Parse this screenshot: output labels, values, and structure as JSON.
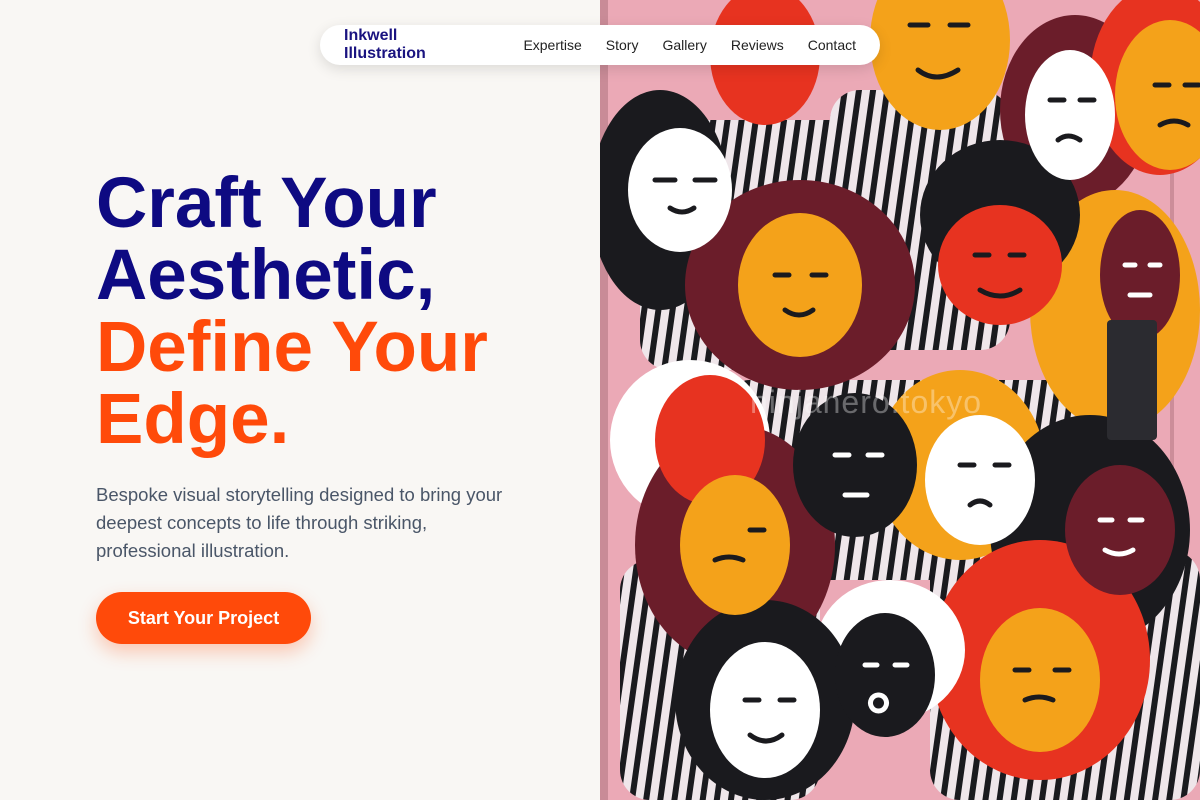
{
  "nav": {
    "brand": "Inkwell Illustration",
    "links": [
      "Expertise",
      "Story",
      "Gallery",
      "Reviews",
      "Contact"
    ]
  },
  "hero": {
    "title_line1": "Craft Your",
    "title_line2": "Aesthetic,",
    "title_line3": "Define Your",
    "title_line4": "Edge.",
    "description": "Bespoke visual storytelling designed to bring your deepest concepts to life through striking, professional illustration.",
    "cta_label": "Start Your Project"
  },
  "artwork": {
    "watermark": "ninjanero.tokyo"
  },
  "colors": {
    "navy": "#0e0a82",
    "accent": "#ff4a0a",
    "background": "#f9f7f4",
    "mural_pink": "#eba9b6"
  }
}
